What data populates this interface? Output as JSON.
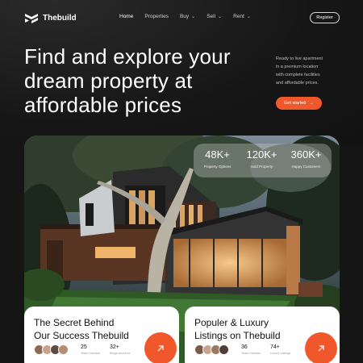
{
  "nav": {
    "logo_text": "Thebuild",
    "links": [
      {
        "label": "Home",
        "dropdown": false
      },
      {
        "label": "Properties",
        "dropdown": false
      },
      {
        "label": "Buy",
        "dropdown": true
      },
      {
        "label": "Sell",
        "dropdown": true
      },
      {
        "label": "Rent",
        "dropdown": true
      }
    ],
    "register_label": "Register"
  },
  "hero": {
    "title_lines": [
      "Find and explore your",
      "dream property at",
      "affordable prices"
    ],
    "description_lines": [
      "Ready to live apartment",
      "in a premium location",
      "with complete facilities",
      "and affordable prices."
    ],
    "cta_label": "Get started",
    "cta_icon": "arrow-right-icon"
  },
  "stats": [
    {
      "value": "48K+",
      "label": "Property Options"
    },
    {
      "value": "120K+",
      "label": "Sold Property"
    },
    {
      "value": "360K+",
      "label": "Happy Customers"
    }
  ],
  "cards": [
    {
      "title_lines": [
        "The Secret Behind",
        "Our Success Thebuild"
      ],
      "metrics": [
        {
          "value": "25",
          "label": "Team member"
        },
        {
          "value": "32+",
          "label": "Blogs about us"
        }
      ],
      "icon": "arrow-up-right-icon"
    },
    {
      "title_lines": [
        "Populer & Luxury",
        "Listings on Thebuild"
      ],
      "metrics": [
        {
          "value": "36",
          "label": "Team member"
        },
        {
          "value": "74+",
          "label": "Luxury Listings"
        }
      ],
      "icon": "arrow-up-right-icon"
    }
  ],
  "colors": {
    "background": "#151515",
    "accent": "#f0582b",
    "card": "#ffffff"
  }
}
